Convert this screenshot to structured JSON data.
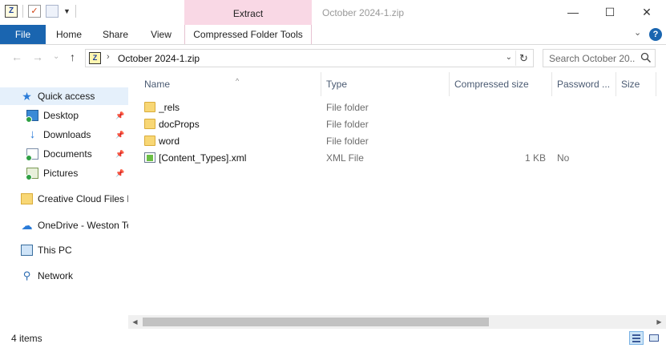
{
  "window": {
    "title": "October 2024-1.zip",
    "contextual_tab": "Extract",
    "controls": {
      "minimize": "—",
      "maximize": "☐",
      "close": "✕"
    }
  },
  "ribbon": {
    "tabs": [
      {
        "label": "File"
      },
      {
        "label": "Home"
      },
      {
        "label": "Share"
      },
      {
        "label": "View"
      },
      {
        "label": "Compressed Folder Tools"
      }
    ],
    "collapse_glyph": "⌄",
    "help_glyph": "?"
  },
  "nav": {
    "back_glyph": "←",
    "forward_glyph": "→",
    "recent_glyph": "⌄",
    "up_glyph": "↑",
    "address_separator": "›",
    "address": "October 2024-1.zip",
    "address_dropdown_glyph": "⌄",
    "refresh_glyph": "↻",
    "search_placeholder": "Search October 20..."
  },
  "navpane": {
    "pin_glyph": "📌",
    "items": [
      {
        "label": "Quick access",
        "icon": "star-icon"
      },
      {
        "label": "Desktop",
        "icon": "desktop-icon"
      },
      {
        "label": "Downloads",
        "icon": "downloads-icon"
      },
      {
        "label": "Documents",
        "icon": "documents-icon"
      },
      {
        "label": "Pictures",
        "icon": "pictures-icon"
      },
      {
        "label": "Creative Cloud Files P",
        "icon": "folder-icon"
      },
      {
        "label": "OneDrive - Weston Te",
        "icon": "cloud-icon"
      },
      {
        "label": "This PC",
        "icon": "computer-icon"
      },
      {
        "label": "Network",
        "icon": "network-icon"
      }
    ]
  },
  "columns": {
    "sort_glyph": "^",
    "name": "Name",
    "type": "Type",
    "compressed_size": "Compressed size",
    "password": "Password ...",
    "size": "Size"
  },
  "files": [
    {
      "name": "_rels",
      "type": "File folder",
      "size": "",
      "password": ""
    },
    {
      "name": "docProps",
      "type": "File folder",
      "size": "",
      "password": ""
    },
    {
      "name": "word",
      "type": "File folder",
      "size": "",
      "password": ""
    },
    {
      "name": "[Content_Types].xml",
      "type": "XML File",
      "size": "1 KB",
      "password": "No"
    }
  ],
  "status": {
    "item_count": "4 items"
  },
  "colors": {
    "file_tab": "#1a65b0",
    "contextual_tab": "#f9d8e5",
    "selected_nav": "#e5f0fb"
  }
}
